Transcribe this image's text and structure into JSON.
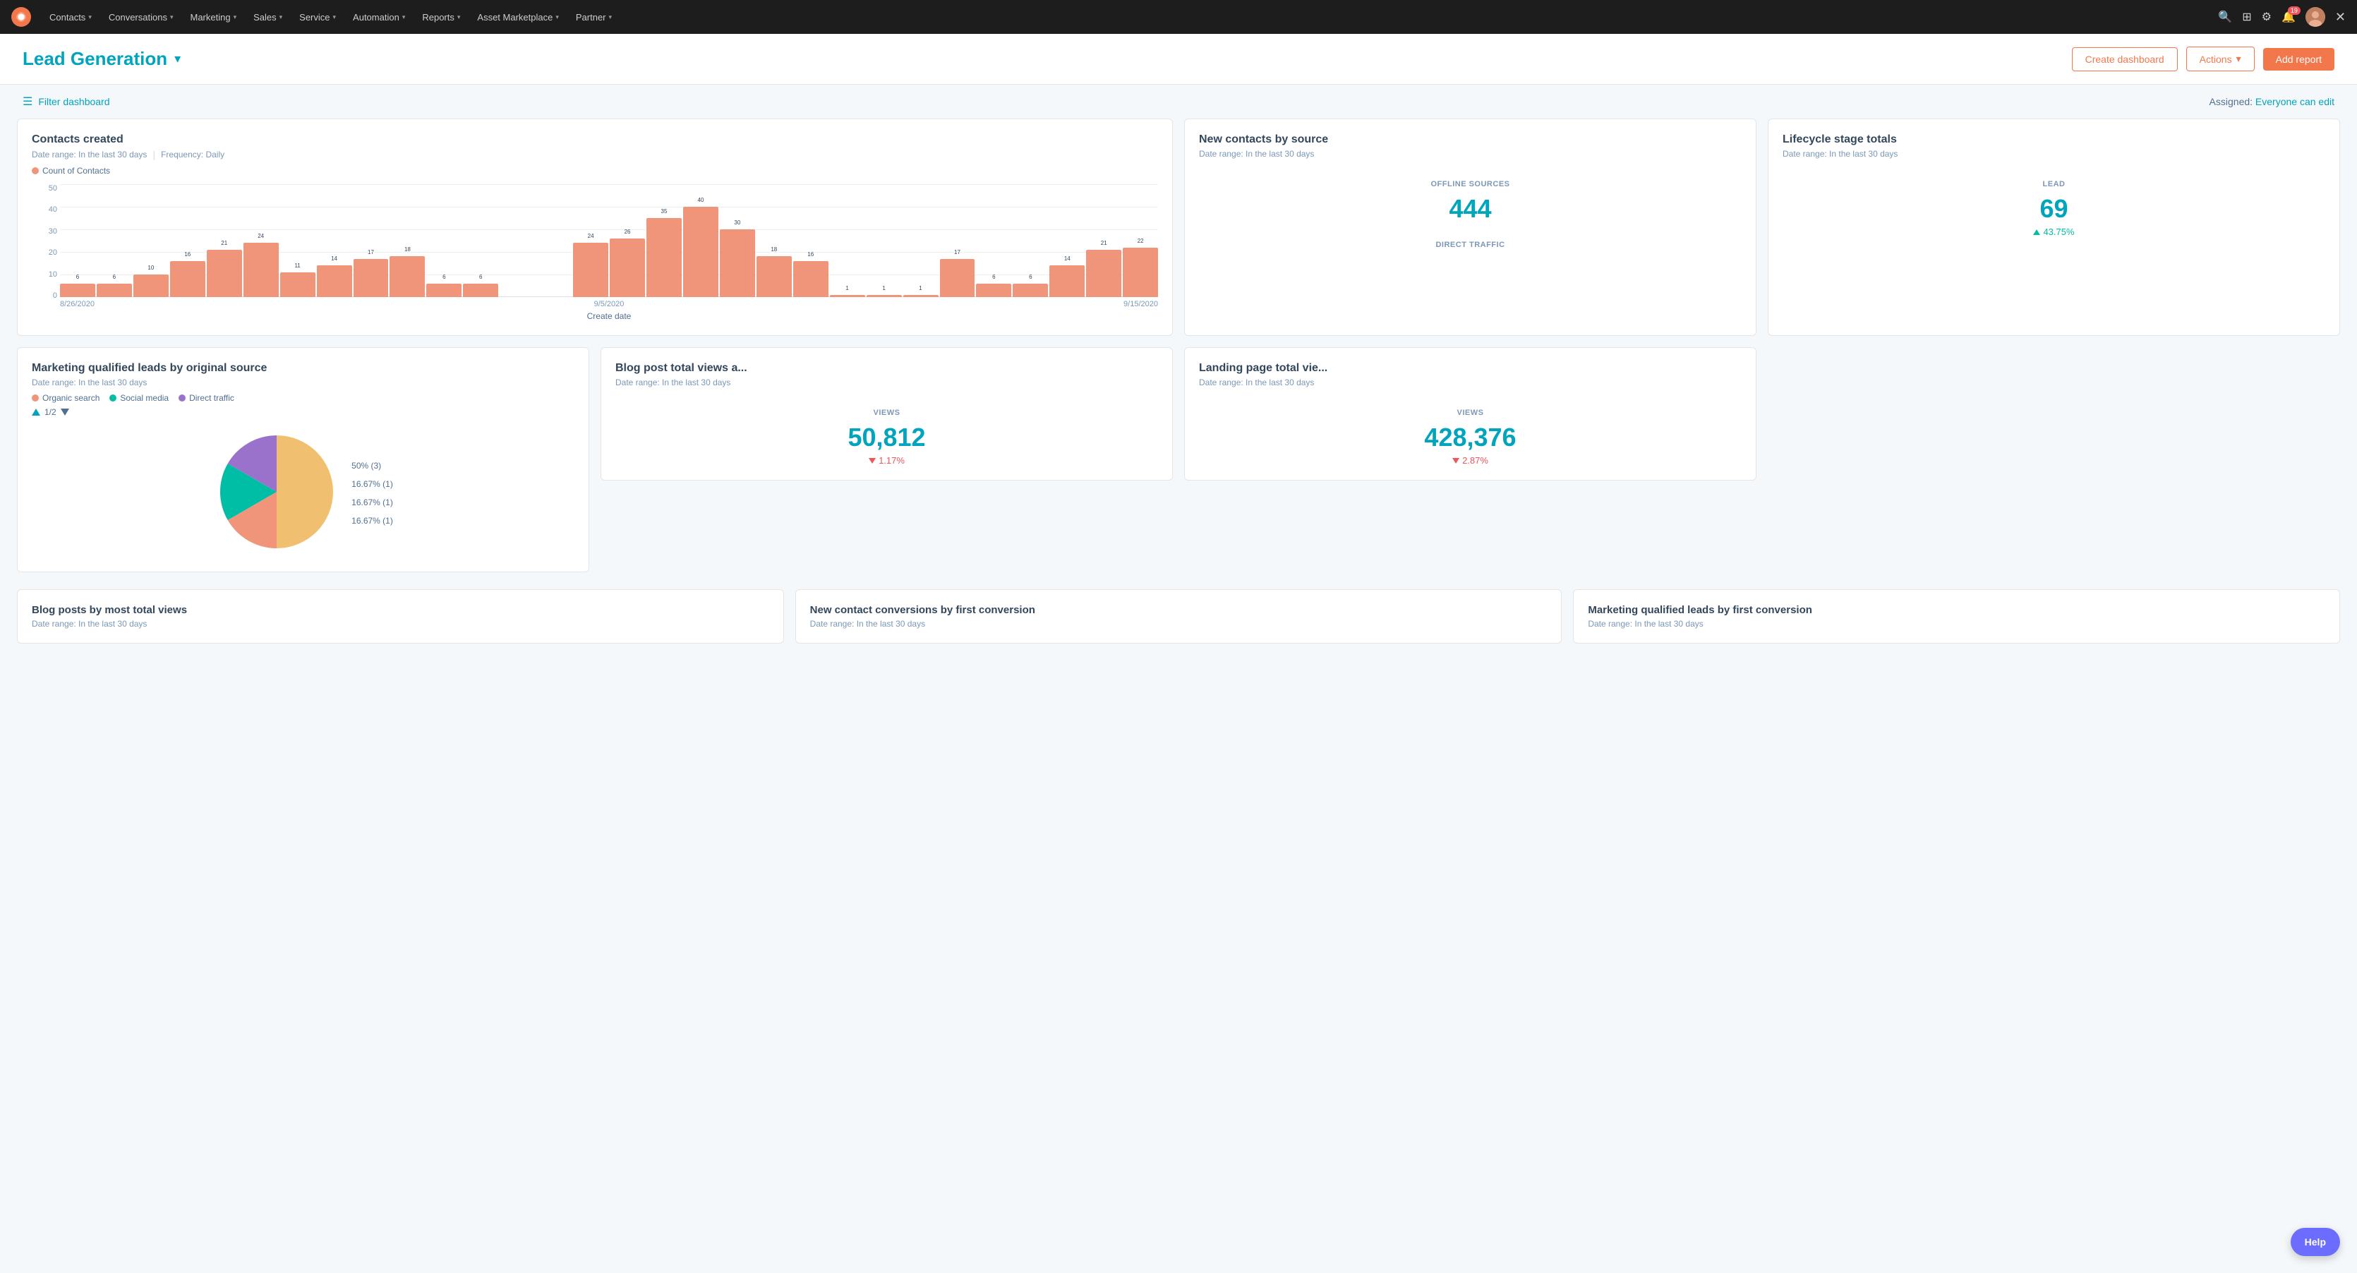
{
  "app": {
    "logo_alt": "HubSpot"
  },
  "nav": {
    "items": [
      {
        "label": "Contacts",
        "id": "contacts"
      },
      {
        "label": "Conversations",
        "id": "conversations"
      },
      {
        "label": "Marketing",
        "id": "marketing"
      },
      {
        "label": "Sales",
        "id": "sales"
      },
      {
        "label": "Service",
        "id": "service"
      },
      {
        "label": "Automation",
        "id": "automation"
      },
      {
        "label": "Reports",
        "id": "reports"
      },
      {
        "label": "Asset Marketplace",
        "id": "asset-marketplace"
      },
      {
        "label": "Partner",
        "id": "partner"
      }
    ],
    "notification_count": "19"
  },
  "header": {
    "title": "Lead Generation",
    "create_dashboard_label": "Create dashboard",
    "actions_label": "Actions",
    "actions_chevron": "▾",
    "add_report_label": "Add report"
  },
  "filter_bar": {
    "filter_label": "Filter dashboard",
    "assigned_label": "Assigned:",
    "assigned_value": "Everyone can edit"
  },
  "cards": {
    "contacts_created": {
      "title": "Contacts created",
      "subtitle_date": "Date range: In the last 30 days",
      "separator": "|",
      "subtitle_freq": "Frequency: Daily",
      "legend_label": "Count of Contacts",
      "legend_color": "#f0957a",
      "y_labels": [
        "50",
        "40",
        "30",
        "20",
        "10",
        "0"
      ],
      "bars": [
        {
          "value": 6,
          "label": ""
        },
        {
          "value": 6,
          "label": ""
        },
        {
          "value": 10,
          "label": ""
        },
        {
          "value": 16,
          "label": ""
        },
        {
          "value": 21,
          "label": ""
        },
        {
          "value": 24,
          "label": ""
        },
        {
          "value": 11,
          "label": ""
        },
        {
          "value": 14,
          "label": ""
        },
        {
          "value": 17,
          "label": ""
        },
        {
          "value": 18,
          "label": ""
        },
        {
          "value": 6,
          "label": ""
        },
        {
          "value": 6,
          "label": ""
        },
        {
          "value": 0,
          "label": ""
        },
        {
          "value": 0,
          "label": ""
        },
        {
          "value": 24,
          "label": ""
        },
        {
          "value": 26,
          "label": ""
        },
        {
          "value": 35,
          "label": ""
        },
        {
          "value": 40,
          "label": ""
        },
        {
          "value": 30,
          "label": ""
        },
        {
          "value": 18,
          "label": ""
        },
        {
          "value": 16,
          "label": ""
        },
        {
          "value": 1,
          "label": ""
        },
        {
          "value": 1,
          "label": ""
        },
        {
          "value": 1,
          "label": ""
        },
        {
          "value": 17,
          "label": ""
        },
        {
          "value": 6,
          "label": ""
        },
        {
          "value": 6,
          "label": ""
        },
        {
          "value": 14,
          "label": ""
        },
        {
          "value": 21,
          "label": ""
        },
        {
          "value": 22,
          "label": ""
        }
      ],
      "x_labels": [
        "8/26/2020",
        "9/5/2020",
        "9/15/2020"
      ],
      "x_axis_title": "Create date",
      "y_axis_title": "Count of Contacts"
    },
    "new_contacts_by_source": {
      "title": "New contacts by source",
      "subtitle": "Date range: In the last 30 days",
      "offline_label": "OFFLINE SOURCES",
      "offline_value": "444",
      "direct_label": "DIRECT TRAFFIC"
    },
    "lifecycle_stage": {
      "title": "Lifecycle stage totals",
      "subtitle": "Date range: In the last 30 days",
      "lead_label": "LEAD",
      "lead_value": "69",
      "lead_change": "43.75%",
      "lead_up": true
    },
    "mql_by_source": {
      "title": "Marketing qualified leads by original source",
      "subtitle": "Date range: In the last 30 days",
      "legend": [
        {
          "label": "Organic search",
          "color": "#f0957a"
        },
        {
          "label": "Social media",
          "color": "#00bda5"
        },
        {
          "label": "Direct traffic",
          "color": "#9b72cb"
        }
      ],
      "pagination": "1/2",
      "pie_segments": [
        {
          "label": "50% (3)",
          "pct": 50,
          "color": "#f0c070",
          "start": 0
        },
        {
          "label": "16.67% (1)",
          "pct": 16.67,
          "color": "#f0957a",
          "start": 180
        },
        {
          "label": "16.67% (1)",
          "pct": 16.67,
          "color": "#00bda5",
          "start": 240
        },
        {
          "label": "16.67% (1)",
          "pct": 16.67,
          "color": "#9b72cb",
          "start": 300
        }
      ]
    },
    "blog_views": {
      "title": "Blog post total views a...",
      "subtitle": "Date range: In the last 30 days",
      "views_label": "VIEWS",
      "views_value": "50,812",
      "change": "1.17%",
      "change_down": true
    },
    "landing_views": {
      "title": "Landing page total vie...",
      "subtitle": "Date range: In the last 30 days",
      "views_label": "VIEWS",
      "views_value": "428,376",
      "change": "2.87%",
      "change_down": true
    }
  },
  "bottom_cards": [
    {
      "title": "Blog posts by most total views",
      "subtitle": "Date range: In the last 30 days"
    },
    {
      "title": "New contact conversions by first conversion",
      "subtitle": "Date range: In the last 30 days"
    },
    {
      "title": "Marketing qualified leads by first conversion",
      "subtitle": "Date range: In the last 30 days"
    }
  ],
  "help_btn": "Help"
}
